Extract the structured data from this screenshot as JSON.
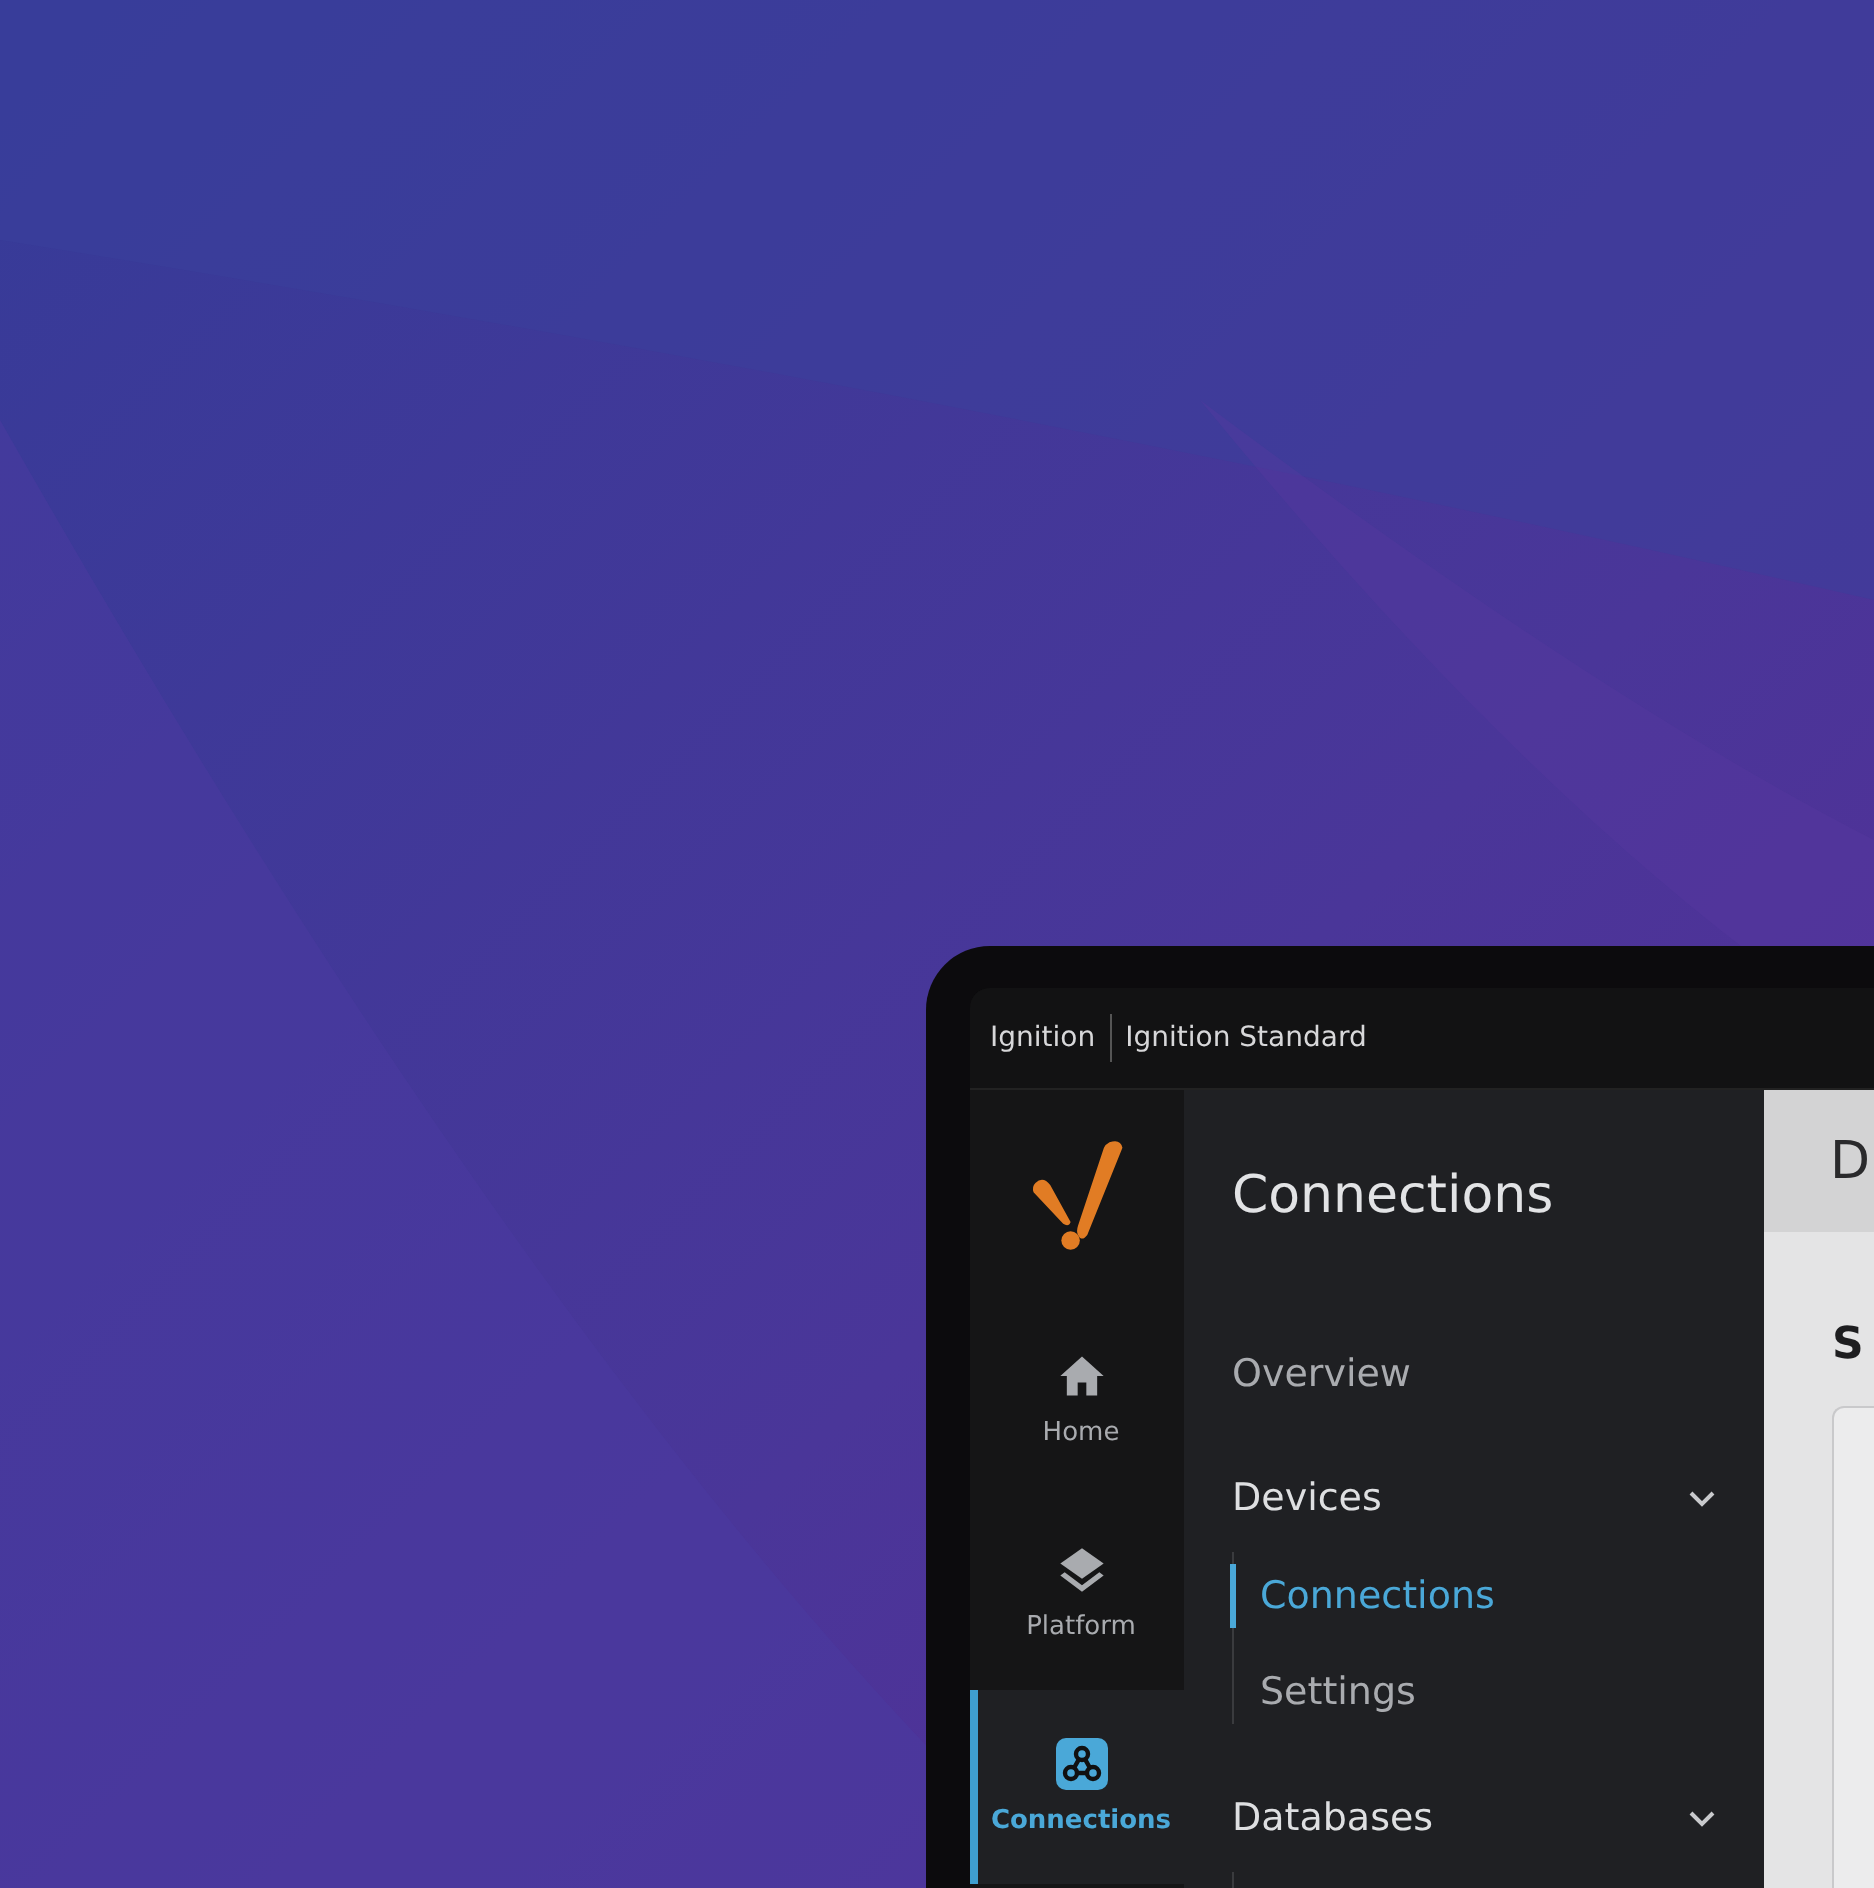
{
  "app_bar": {
    "product": "Ignition",
    "edition": "Ignition Standard"
  },
  "nav_rail": [
    {
      "label": "Home",
      "kind": "home",
      "selected": false
    },
    {
      "label": "Platform",
      "kind": "platform",
      "selected": false
    },
    {
      "label": "Connections",
      "kind": "connections",
      "selected": true
    }
  ],
  "section_menu": {
    "title": "Connections",
    "items": [
      {
        "label": "Overview",
        "kind": "link"
      },
      {
        "label": "Devices",
        "kind": "group",
        "expanded": true,
        "children": [
          {
            "label": "Connections",
            "selected": true
          },
          {
            "label": "Settings",
            "selected": false
          }
        ]
      },
      {
        "label": "Databases",
        "kind": "group",
        "expanded": true
      }
    ]
  },
  "main": {
    "page_title": "D",
    "section_title": "S"
  }
}
